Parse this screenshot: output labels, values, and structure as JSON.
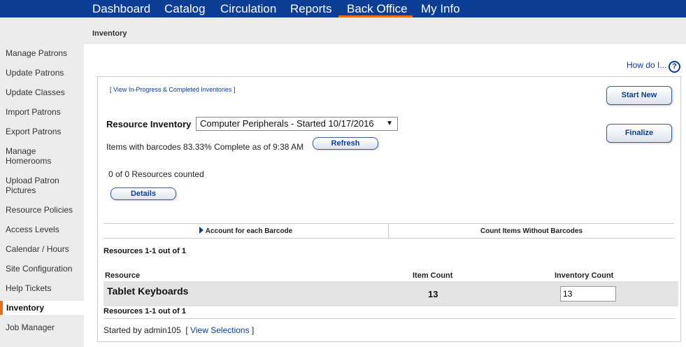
{
  "topnav": {
    "items": [
      {
        "label": "Dashboard"
      },
      {
        "label": "Catalog"
      },
      {
        "label": "Circulation"
      },
      {
        "label": "Reports"
      },
      {
        "label": "Back Office",
        "active": true
      },
      {
        "label": "My Info"
      }
    ]
  },
  "breadcrumb": "Inventory",
  "sidebar": {
    "items": [
      {
        "label": "Manage Patrons"
      },
      {
        "label": "Update Patrons"
      },
      {
        "label": "Update Classes"
      },
      {
        "label": "Import Patrons"
      },
      {
        "label": "Export Patrons"
      },
      {
        "label": "Manage Homerooms"
      },
      {
        "label": "Upload Patron Pictures"
      },
      {
        "label": "Resource Policies"
      },
      {
        "label": "Access Levels"
      },
      {
        "label": "Calendar / Hours"
      },
      {
        "label": "Site Configuration"
      },
      {
        "label": "Help Tickets"
      },
      {
        "label": "Inventory",
        "active": true
      },
      {
        "label": "Job Manager"
      }
    ]
  },
  "help": {
    "how_do_i": "How do I...",
    "icon": "question-circle-icon",
    "icon_glyph": "?"
  },
  "panel": {
    "view_link_open": "[ ",
    "view_link_label": "View In-Progress & Completed Inventories",
    "view_link_close": " ]",
    "start_new_label": "Start New",
    "finalize_label": "Finalize",
    "resource_inventory_label": "Resource Inventory",
    "inventory_select_value": "Computer Peripherals - Started 10/17/2016",
    "barcode_status": "Items with barcodes 83.33% Complete as of 9:38 AM",
    "refresh_label": "Refresh",
    "counted_text": "0 of 0 Resources counted",
    "details_label": "Details",
    "tabs": [
      {
        "label": "Account for each Barcode",
        "active": true
      },
      {
        "label": "Count Items Without Barcodes"
      }
    ],
    "results_count": "Resources 1-1 out of 1",
    "table": {
      "columns": [
        "Resource",
        "Item Count",
        "Inventory Count"
      ],
      "rows": [
        {
          "resource": "Tablet Keyboards",
          "item_count": "13",
          "inventory_count": "13"
        }
      ]
    },
    "started_by": "Started by admin105",
    "view_selections_open": "[ ",
    "view_selections_label": "View Selections",
    "view_selections_close": " ]"
  },
  "colors": {
    "nav_bg": "#0b3e94",
    "accent": "#e86e1f",
    "sidebar_bg": "#ececec",
    "link": "#0b3e94"
  }
}
